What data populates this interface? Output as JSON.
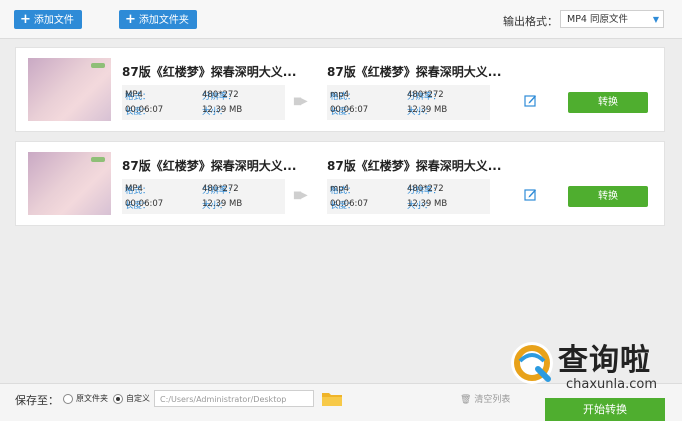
{
  "toolbar": {
    "add_file_label": "添加文件",
    "add_folder_label": "添加文件夹",
    "output_format_label": "输出格式：",
    "output_format_value": "MP4  同原文件"
  },
  "items": [
    {
      "source": {
        "title": "87版《红楼梦》探春深明大义...",
        "format_key": "格式：",
        "format": "MP4",
        "resolution_key": "分辨率：",
        "resolution": "480*272",
        "duration_key": "长度：",
        "duration": "00:06:07",
        "size_key": "大小：",
        "size": "12.39 MB"
      },
      "target": {
        "title": "87版《红楼梦》探春深明大义...",
        "format_key": "格式：",
        "format": "mp4",
        "resolution_key": "分辨率：",
        "resolution": "480*272",
        "duration_key": "长度：",
        "duration": "00:06:07",
        "size_key": "大小：",
        "size": "12.39 MB"
      },
      "convert_label": "转换"
    },
    {
      "source": {
        "title": "87版《红楼梦》探春深明大义...",
        "format_key": "格式：",
        "format": "MP4",
        "resolution_key": "分辨率：",
        "resolution": "480*272",
        "duration_key": "长度：",
        "duration": "00:06:07",
        "size_key": "大小：",
        "size": "12.39 MB"
      },
      "target": {
        "title": "87版《红楼梦》探春深明大义...",
        "format_key": "格式：",
        "format": "mp4",
        "resolution_key": "分辨率：",
        "resolution": "480*272",
        "duration_key": "长度：",
        "duration": "00:06:07",
        "size_key": "大小：",
        "size": "12.39 MB"
      },
      "convert_label": "转换"
    }
  ],
  "bottom": {
    "save_to_label": "保存至：",
    "option_original": "原文件夹",
    "option_custom": "自定义",
    "path": "C:/Users/Administrator/Desktop",
    "clear_list_label": "清空列表",
    "start_label": "开始转换"
  },
  "watermark": {
    "cn": "查询啦",
    "en": "chaxunla.com"
  },
  "colors": {
    "accent": "#2e8bd7",
    "convert": "#4fae2f"
  }
}
